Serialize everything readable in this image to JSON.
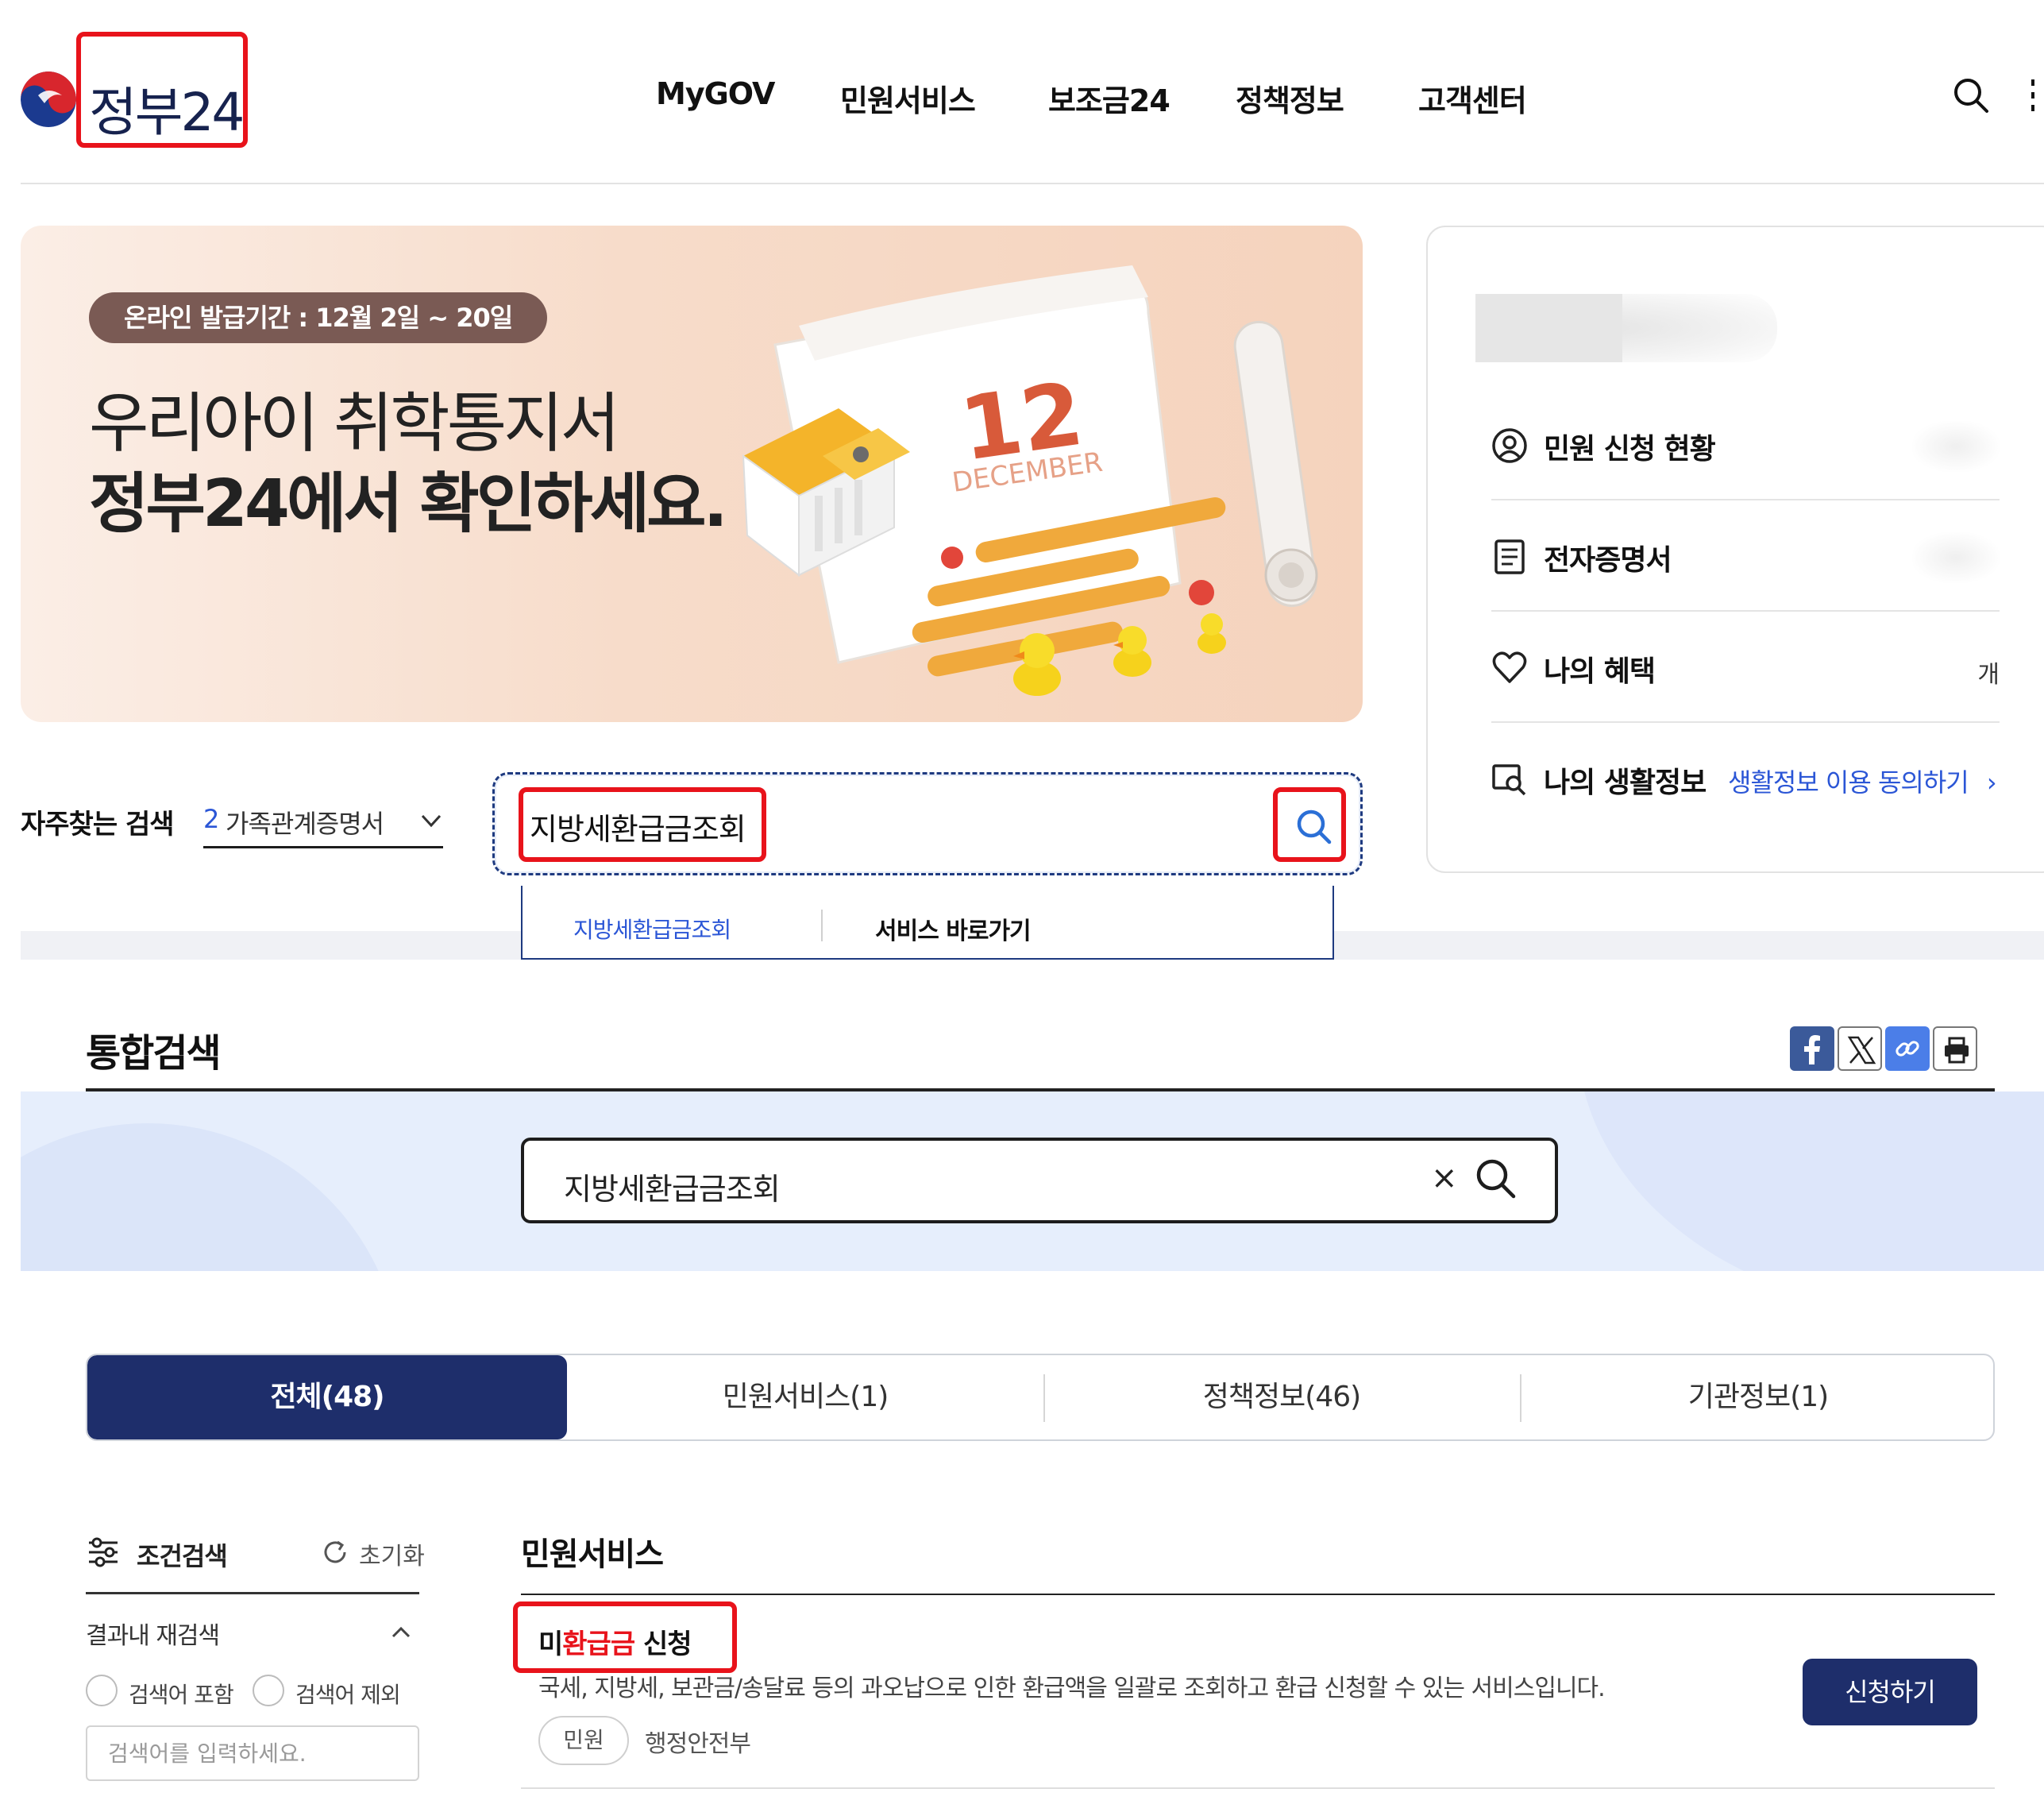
{
  "header": {
    "logo_text": "정부24",
    "nav": [
      "MyGOV",
      "민원서비스",
      "보조금24",
      "정책정보",
      "고객센터"
    ]
  },
  "banner": {
    "pill": "온라인 발급기간 : 12월 2일 ~ 20일",
    "line1": "우리아이 취학통지서",
    "line2": "정부24에서 확인하세요.",
    "calendar_number": "12",
    "calendar_month": "DECEMBER"
  },
  "panel": {
    "items": [
      {
        "label": "민원 신청 현황",
        "icon": "person-circle-icon"
      },
      {
        "label": "전자증명서",
        "icon": "document-icon"
      },
      {
        "label": "나의 혜택",
        "icon": "heart-icon",
        "unit": "개"
      },
      {
        "label": "나의 생활정보",
        "icon": "life-search-icon",
        "link": "생활정보 이용 동의하기"
      }
    ]
  },
  "search_row": {
    "freq_label": "자주찾는 검색",
    "freq_num": "2",
    "freq_text": "가족관계증명서",
    "query": "지방세환급금조회",
    "dropdown_item": "지방세환급금조회",
    "dropdown_action": "서비스 바로가기"
  },
  "integrated": {
    "title": "통합검색",
    "share_icons": [
      "facebook-icon",
      "x-icon",
      "link-icon",
      "print-icon"
    ],
    "query": "지방세환급금조회",
    "clear": "×"
  },
  "tabs": [
    "전체(48)",
    "민원서비스(1)",
    "정책정보(46)",
    "기관정보(1)"
  ],
  "filter": {
    "title": "조건검색",
    "reset": "초기화",
    "sub": "결과내 재검색",
    "include": "검색어 포함",
    "exclude": "검색어 제외",
    "placeholder": "검색어를 입력하세요."
  },
  "results": {
    "section": "민원서비스",
    "item": {
      "title_pre": "미",
      "title_hl": "환급금",
      "title_post": " 신청",
      "desc": "국세, 지방세, 보관금/송달료 등의 과오납으로 인한 환급액을 일괄로 조회하고 환급 신청할 수 있는 서비스입니다.",
      "tag": "민원",
      "org": "행정안전부",
      "button": "신청하기"
    }
  },
  "colors": {
    "navy": "#1e2e6b",
    "highlight_red": "#e8131b",
    "link_blue": "#2b56d6"
  }
}
